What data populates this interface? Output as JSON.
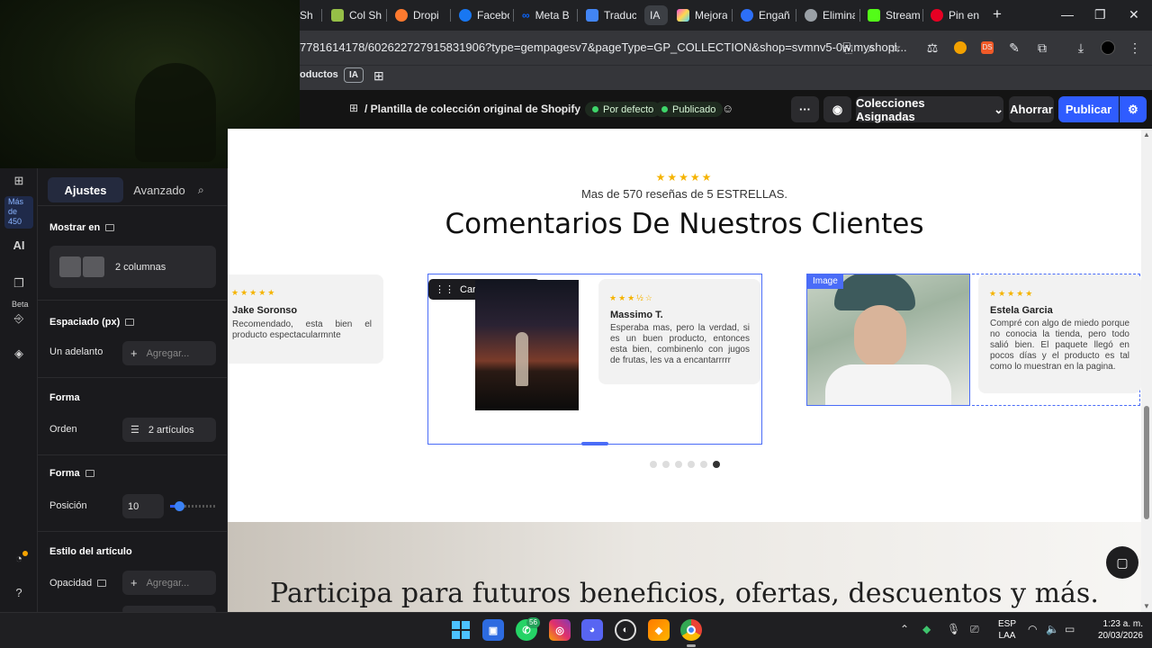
{
  "browser": {
    "tabs": [
      {
        "label": "Sh",
        "color": "#95bf47"
      },
      {
        "label": "Col Sh",
        "color": "#95bf47"
      },
      {
        "label": "Dropi",
        "color": "#ff7a2f"
      },
      {
        "label": "Facebo",
        "color": "#1877f2"
      },
      {
        "label": "Meta B",
        "color": "#0a66ff"
      },
      {
        "label": "Traduc",
        "color": "#4285f4"
      },
      {
        "label": "IA",
        "color": "#5f6368"
      },
      {
        "label": "Mejora",
        "color": "#e04cff"
      },
      {
        "label": "Engañ",
        "color": "#2d6ff7"
      },
      {
        "label": "Elimina",
        "color": "#9aa0a6"
      },
      {
        "label": "Stream",
        "color": "#53fc18"
      },
      {
        "label": "Pin en",
        "color": "#e60023"
      }
    ],
    "url": "7781614178/602622727915831906?type=gempagesv7&pageType=GP_COLLECTION&shop=svmnv5-0w.myshopi...",
    "bookmarks": {
      "first": "oductos",
      "ia": "IA"
    }
  },
  "editor": {
    "breadcrumb": "/ Plantilla de colección original de Shopify",
    "pill_default": "Por defecto",
    "pill_published": "Publicado",
    "collections_button": "Colecciones Asignadas",
    "save_button": "Ahorrar",
    "publish_button": "Publicar"
  },
  "rail": {
    "more_line1": "Más",
    "more_line2": "de",
    "more_line3": "450",
    "ai": "AI",
    "beta": "Beta"
  },
  "panel": {
    "tab_settings": "Ajustes",
    "tab_advanced": "Avanzado",
    "show_on": "Mostrar en",
    "columns": "2 columnas",
    "spacing": "Espaciado (px)",
    "advance_label": "Un adelanto",
    "add_placeholder": "Agregar...",
    "form": "Forma",
    "order_label": "Orden",
    "order_value": "2 artículos",
    "form2": "Forma",
    "position_label": "Posición",
    "position_value": "10",
    "position_fraction": 0.2,
    "item_style": "Estilo del artículo",
    "opacity_label": "Opacidad",
    "opacity_placeholder": "Agregar..."
  },
  "page": {
    "rating_stars": "★★★★★",
    "rating_text": "Mas de 570 reseñas de 5 ESTRELLAS.",
    "heading": "Comentarios De Nuestros Clientes",
    "carousel_label": "Carousel",
    "image_label": "Image",
    "reviews": [
      {
        "stars": "★★★★★",
        "name": "Jake Soronso",
        "text": "Recomendado, esta bien el producto espectacularmnte"
      },
      {
        "stars": "★★★½☆",
        "name": "Massimo T.",
        "text": "Esperaba mas, pero la verdad, si es un buen producto, entonces esta bien, combinenlo con jugos de frutas, les va a encantarrrrr"
      },
      {
        "stars": "★★★★★",
        "name": "Estela Garcia",
        "text": "Compré con algo de miedo porque no conocia la tienda, pero todo salió bien. El paquete llegó en pocos días y el producto es tal como lo muestran en la pagina."
      }
    ],
    "dots_total": 6,
    "dots_active": 6,
    "banner_text": "Participa para futuros beneficios, ofertas, descuentos y más."
  },
  "taskbar": {
    "whatsapp_badge": "56",
    "lang1": "ESP",
    "lang2": "LAA",
    "time": "1:23 a. m.",
    "date": "20/03/2026"
  },
  "colors": {
    "accent": "#2f5cff",
    "star": "#f5b301",
    "green": "#3ed46a"
  }
}
